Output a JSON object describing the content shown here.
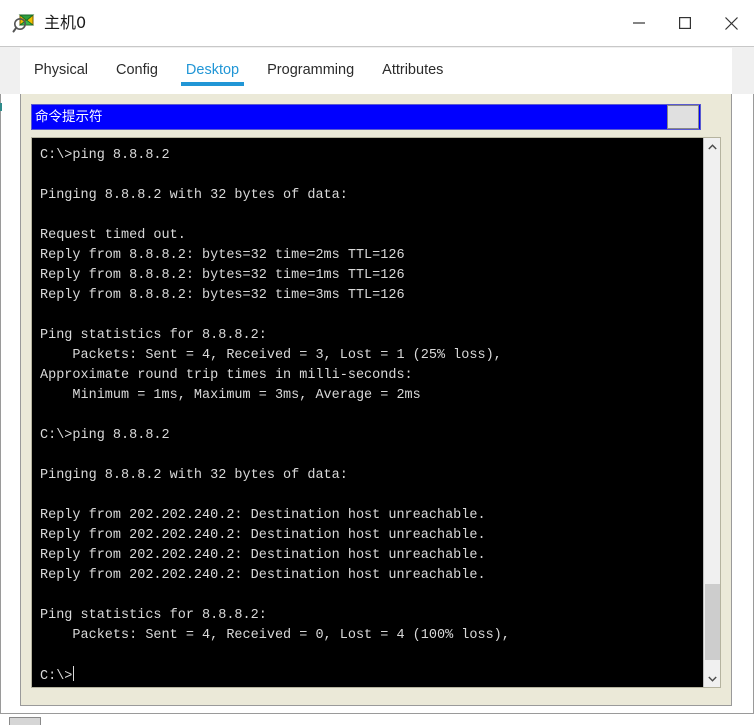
{
  "window": {
    "title": "主机0",
    "icon": "inspect-magnifier-icon",
    "controls": {
      "minimize": "–",
      "maximize": "□",
      "close": "✕"
    }
  },
  "tabs": [
    {
      "label": "Physical",
      "active": false
    },
    {
      "label": "Config",
      "active": false
    },
    {
      "label": "Desktop",
      "active": true
    },
    {
      "label": "Programming",
      "active": false
    },
    {
      "label": "Attributes",
      "active": false
    }
  ],
  "cmd_window": {
    "title": "命令提示符",
    "corner_button_label": ""
  },
  "terminal": {
    "lines": [
      "C:\\>ping 8.8.8.2",
      "",
      "Pinging 8.8.8.2 with 32 bytes of data:",
      "",
      "Request timed out.",
      "Reply from 8.8.8.2: bytes=32 time=2ms TTL=126",
      "Reply from 8.8.8.2: bytes=32 time=1ms TTL=126",
      "Reply from 8.8.8.2: bytes=32 time=3ms TTL=126",
      "",
      "Ping statistics for 8.8.8.2:",
      "    Packets: Sent = 4, Received = 3, Lost = 1 (25% loss),",
      "Approximate round trip times in milli-seconds:",
      "    Minimum = 1ms, Maximum = 3ms, Average = 2ms",
      "",
      "C:\\>ping 8.8.8.2",
      "",
      "Pinging 8.8.8.2 with 32 bytes of data:",
      "",
      "Reply from 202.202.240.2: Destination host unreachable.",
      "Reply from 202.202.240.2: Destination host unreachable.",
      "Reply from 202.202.240.2: Destination host unreachable.",
      "Reply from 202.202.240.2: Destination host unreachable.",
      "",
      "Ping statistics for 8.8.8.2:",
      "    Packets: Sent = 4, Received = 0, Lost = 4 (100% loss),",
      ""
    ],
    "prompt": "C:\\>"
  },
  "scrollbar": {
    "up_arrow": "⌃",
    "down_arrow": "⌄"
  },
  "colors": {
    "accent": "#2196d6",
    "panel": "#ebe9d8",
    "cmd_titlebar": "#0000ff",
    "terminal_bg": "#000000",
    "terminal_fg": "#d9d9d9"
  }
}
